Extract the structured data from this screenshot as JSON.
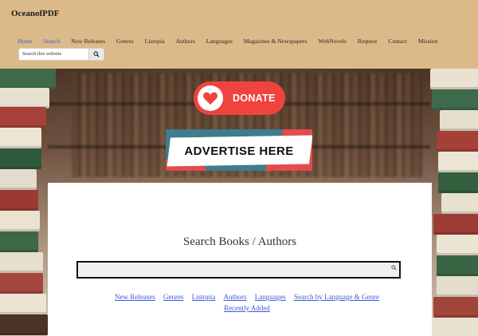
{
  "site": {
    "title": "OceanofPDF"
  },
  "nav": {
    "items": [
      {
        "label": "Home",
        "active": true
      },
      {
        "label": "Search",
        "active": true
      },
      {
        "label": "New Releases"
      },
      {
        "label": "Genres"
      },
      {
        "label": "Listopia"
      },
      {
        "label": "Authors"
      },
      {
        "label": "Languages"
      },
      {
        "label": "Magazines & Newspapers"
      },
      {
        "label": "WebNovels"
      },
      {
        "label": "Request"
      },
      {
        "label": "Contact"
      },
      {
        "label": "Mission"
      }
    ]
  },
  "top_search": {
    "placeholder": "Search this website",
    "icon": "search-icon"
  },
  "banners": {
    "donate_label": "DONATE",
    "advertise_label": "ADVERTISE HERE"
  },
  "main": {
    "heading": "Search Books / Authors",
    "search_value": "",
    "links": [
      "New Releases",
      "Genres",
      "Listopia",
      "Authors",
      "Languages",
      "Search by Language & Genre",
      "Recently Added"
    ]
  },
  "colors": {
    "header_bg": "#dcb989",
    "nav_active": "#3a5fd0",
    "donate": "#f0433f",
    "link": "#3b5bd6"
  }
}
